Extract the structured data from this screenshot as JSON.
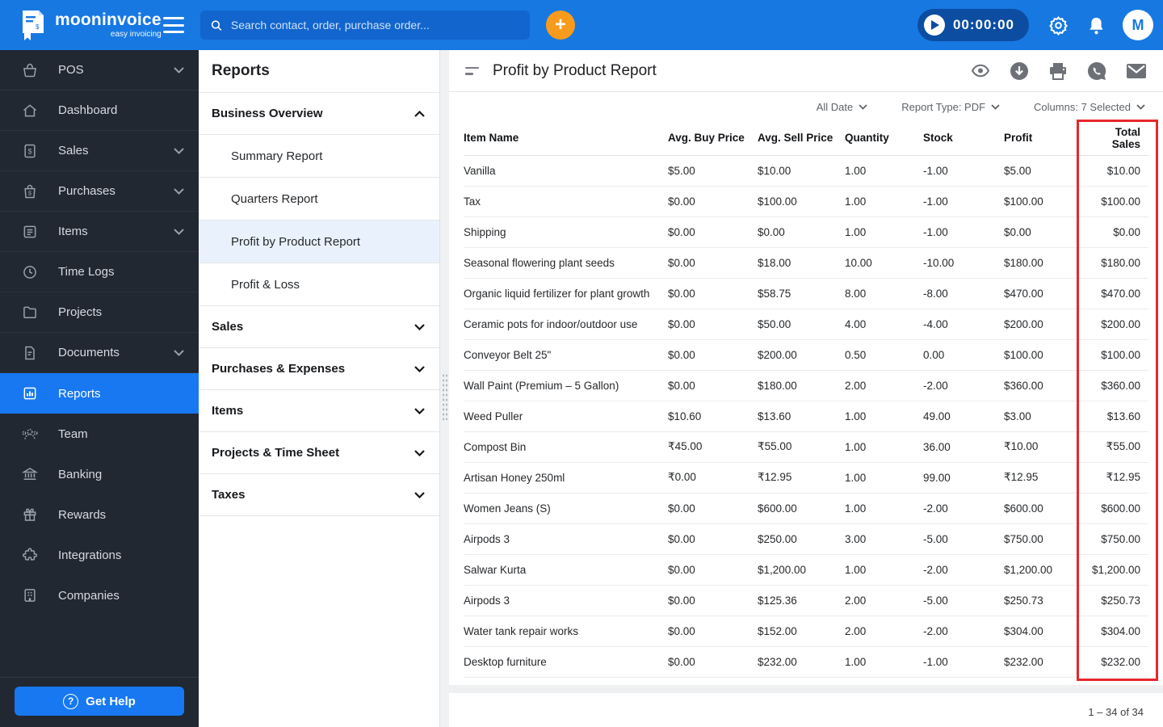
{
  "topbar": {
    "brand_name": "mooninvoice",
    "brand_tagline": "easy invoicing",
    "search_placeholder": "Search contact, order, purchase order...",
    "timer": "00:00:00",
    "avatar_initial": "M"
  },
  "sidebar": {
    "items": [
      {
        "label": "POS"
      },
      {
        "label": "Dashboard"
      },
      {
        "label": "Sales"
      },
      {
        "label": "Purchases"
      },
      {
        "label": "Items"
      },
      {
        "label": "Time Logs"
      },
      {
        "label": "Projects"
      },
      {
        "label": "Documents"
      },
      {
        "label": "Reports"
      },
      {
        "label": "Team"
      },
      {
        "label": "Banking"
      },
      {
        "label": "Rewards"
      },
      {
        "label": "Integrations"
      },
      {
        "label": "Companies"
      }
    ],
    "help_button": "Get Help"
  },
  "reports_panel": {
    "title": "Reports",
    "sections": [
      {
        "label": "Business Overview",
        "expanded": true,
        "children": [
          "Summary Report",
          "Quarters Report",
          "Profit by Product Report",
          "Profit & Loss"
        ],
        "selected_child": "Profit by Product Report"
      },
      {
        "label": "Sales"
      },
      {
        "label": "Purchases & Expenses"
      },
      {
        "label": "Items"
      },
      {
        "label": "Projects & Time Sheet"
      },
      {
        "label": "Taxes"
      }
    ]
  },
  "main": {
    "title": "Profit by Product Report",
    "filters": {
      "date": "All Date",
      "report_type": "Report Type: PDF",
      "columns": "Columns: 7 Selected"
    },
    "highlight_color": "#e8262c",
    "pagination": "1 – 34 of 34"
  },
  "table": {
    "columns": [
      "Item Name",
      "Avg. Buy Price",
      "Avg. Sell Price",
      "Quantity",
      "Stock",
      "Profit",
      "Total Sales"
    ],
    "rows": [
      [
        "Vanilla",
        "$5.00",
        "$10.00",
        "1.00",
        "-1.00",
        "$5.00",
        "$10.00"
      ],
      [
        "Tax",
        "$0.00",
        "$100.00",
        "1.00",
        "-1.00",
        "$100.00",
        "$100.00"
      ],
      [
        "Shipping",
        "$0.00",
        "$0.00",
        "1.00",
        "-1.00",
        "$0.00",
        "$0.00"
      ],
      [
        "Seasonal flowering plant seeds",
        "$0.00",
        "$18.00",
        "10.00",
        "-10.00",
        "$180.00",
        "$180.00"
      ],
      [
        "Organic liquid fertilizer for plant growth",
        "$0.00",
        "$58.75",
        "8.00",
        "-8.00",
        "$470.00",
        "$470.00"
      ],
      [
        "Ceramic pots for indoor/outdoor use",
        "$0.00",
        "$50.00",
        "4.00",
        "-4.00",
        "$200.00",
        "$200.00"
      ],
      [
        "Conveyor Belt 25\"",
        "$0.00",
        "$200.00",
        "0.50",
        "0.00",
        "$100.00",
        "$100.00"
      ],
      [
        "Wall Paint (Premium – 5 Gallon)",
        "$0.00",
        "$180.00",
        "2.00",
        "-2.00",
        "$360.00",
        "$360.00"
      ],
      [
        "Weed Puller",
        "$10.60",
        "$13.60",
        "1.00",
        "49.00",
        "$3.00",
        "$13.60"
      ],
      [
        "Compost Bin",
        "₹45.00",
        "₹55.00",
        "1.00",
        "36.00",
        "₹10.00",
        "₹55.00"
      ],
      [
        "Artisan Honey 250ml",
        "₹0.00",
        "₹12.95",
        "1.00",
        "99.00",
        "₹12.95",
        "₹12.95"
      ],
      [
        "Women Jeans (S)",
        "$0.00",
        "$600.00",
        "1.00",
        "-2.00",
        "$600.00",
        "$600.00"
      ],
      [
        "Airpods 3",
        "$0.00",
        "$250.00",
        "3.00",
        "-5.00",
        "$750.00",
        "$750.00"
      ],
      [
        "Salwar Kurta",
        "$0.00",
        "$1,200.00",
        "1.00",
        "-2.00",
        "$1,200.00",
        "$1,200.00"
      ],
      [
        "Airpods 3",
        "$0.00",
        "$125.36",
        "2.00",
        "-5.00",
        "$250.73",
        "$250.73"
      ],
      [
        "Water tank repair works",
        "$0.00",
        "$152.00",
        "2.00",
        "-2.00",
        "$304.00",
        "$304.00"
      ],
      [
        "Desktop furniture",
        "$0.00",
        "$232.00",
        "1.00",
        "-1.00",
        "$232.00",
        "$232.00"
      ]
    ]
  }
}
